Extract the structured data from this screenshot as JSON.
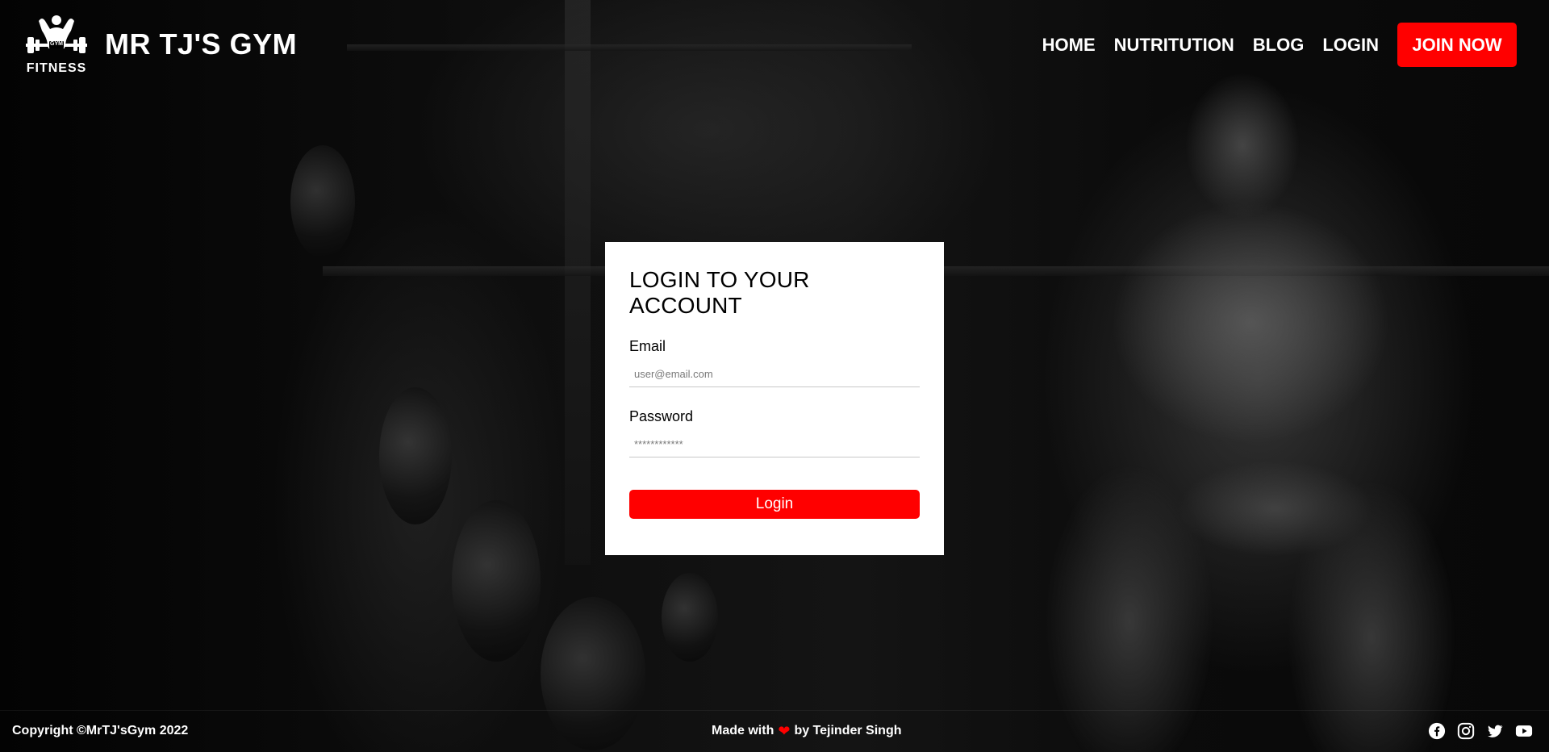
{
  "header": {
    "brand_name": "MR TJ'S GYM",
    "logo_text": "FITNESS",
    "logo_badge": "GYM",
    "nav": [
      {
        "label": "HOME"
      },
      {
        "label": "NUTRITUTION"
      },
      {
        "label": "BLOG"
      },
      {
        "label": "LOGIN"
      }
    ],
    "cta_label": "JOIN NOW"
  },
  "login_form": {
    "title": "LOGIN TO YOUR ACCOUNT",
    "email_label": "Email",
    "email_placeholder": "user@email.com",
    "password_label": "Password",
    "password_placeholder": "************",
    "submit_label": "Login"
  },
  "footer": {
    "copyright": "Copyright ©MrTJ'sGym 2022",
    "made_with_prefix": "Made with",
    "made_with_suffix": "by Tejinder Singh",
    "socials": [
      "facebook-icon",
      "instagram-icon",
      "twitter-icon",
      "youtube-icon"
    ]
  },
  "colors": {
    "accent": "#ff0000",
    "card_bg": "#ffffff",
    "text_light": "#ffffff"
  }
}
